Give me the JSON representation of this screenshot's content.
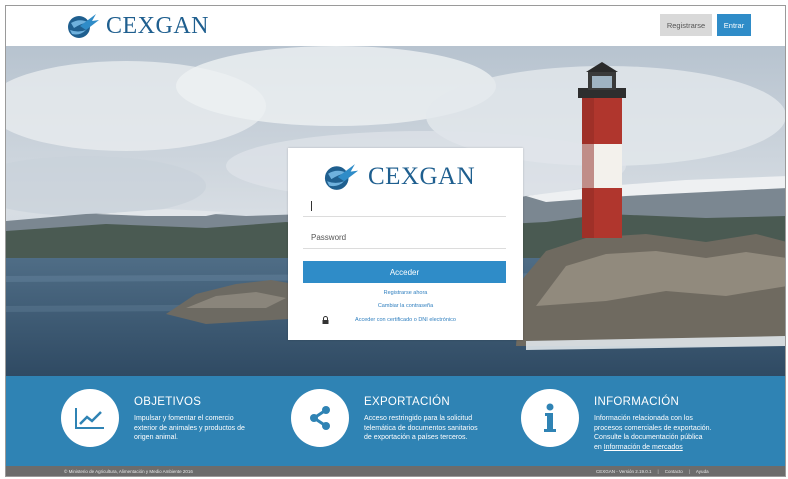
{
  "brand": {
    "name": "CEXGAN"
  },
  "header": {
    "register_label": "Registrarse",
    "enter_label": "Entrar"
  },
  "login": {
    "user_placeholder": "",
    "password_placeholder": "Password",
    "submit_label": "Acceder",
    "register_link": "Registrarse ahora",
    "change_password_link": "Cambiar la contraseña",
    "certificate_link": "Acceder con certificado o DNI electrónico"
  },
  "info": [
    {
      "title": "OBJETIVOS",
      "lines": [
        "Impulsar y fomentar el comercio",
        "exterior de animales y productos de",
        "origen animal."
      ],
      "icon": "chart-line-icon"
    },
    {
      "title": "EXPORTACIÓN",
      "lines": [
        "Acceso restringido para la solicitud",
        "telemática de documentos sanitarios",
        "de exportación a países terceros."
      ],
      "icon": "share-icon"
    },
    {
      "title": "INFORMACIÓN",
      "lines": [
        "Información relacionada con los",
        "procesos comerciales de exportación.",
        "Consulte la documentación pública"
      ],
      "link_prefix": "en ",
      "link": "Información de mercados",
      "icon": "info-icon"
    }
  ],
  "footer": {
    "copyright": "© Ministerio de Agricultura, Alimentación y Medio Ambiente 2016",
    "version": "CEXGAN - Versión 2.19.0.1",
    "contact": "Contacto",
    "help": "Ayuda"
  },
  "colors": {
    "primary": "#2f8cc8",
    "band": "#2f83b4",
    "brand_text": "#1f5f8f",
    "footer": "#6c6c6c"
  }
}
